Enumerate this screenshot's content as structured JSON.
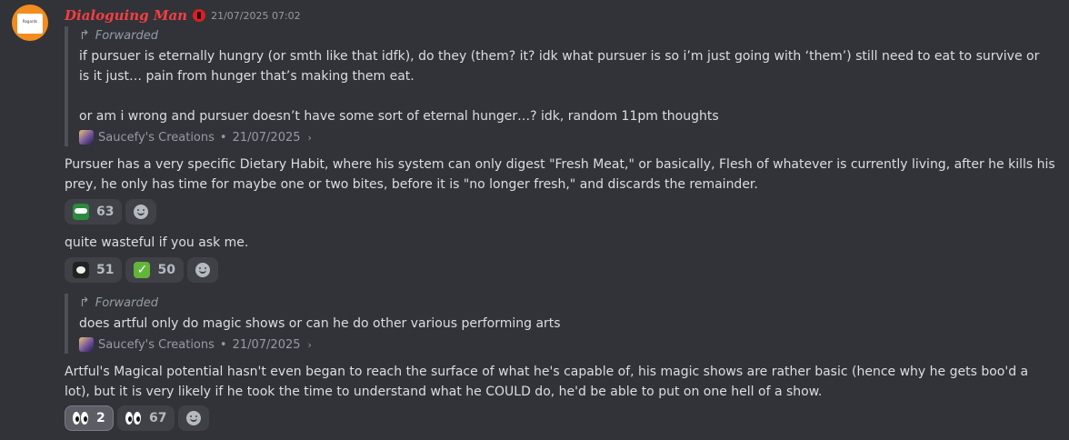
{
  "author": {
    "name": "Dialoguing Man",
    "timestamp": "21/07/2025 07:02",
    "avatar_text": "Regards"
  },
  "forward1": {
    "label": "Forwarded",
    "line1": "if pursuer is eternally hungry (or smth like that idfk), do they (them? it? idk what pursuer is so i’m just going with ‘them’) still need to eat to survive or is it just… pain from hunger that’s making them eat.",
    "line2": "or am i wrong and pursuer doesn’t have some sort of eternal hunger…? idk, random 11pm thoughts",
    "source": "Saucefy's Creations",
    "date": "21/07/2025"
  },
  "msg1": "Pursuer has a very specific Dietary Habit, where his system can only digest \"Fresh Meat,\" or basically, Flesh of whatever is currently living, after he kills his prey, he only has time for maybe one or two bites, before it is \"no longer fresh,\" and discards the remainder.",
  "reactions1": [
    {
      "icon": "green-face-emoji",
      "count": "63"
    }
  ],
  "msg2": "quite wasteful if you ask me.",
  "reactions2": [
    {
      "icon": "panda-emoji",
      "count": "51"
    },
    {
      "icon": "check-mark-emoji",
      "count": "50"
    }
  ],
  "forward2": {
    "label": "Forwarded",
    "text": "does artful only do magic shows or can he do other various performing arts",
    "source": "Saucefy's Creations",
    "date": "21/07/2025"
  },
  "msg3": "Artful's Magical potential hasn't even began to reach the surface of what he's capable of, his magic shows are rather basic (hence why he gets boo'd a lot), but it is very likely if he took the time to understand what he COULD do, he'd be able to put on one hell of a show.",
  "reactions3": [
    {
      "icon": "eyes-emoji",
      "count": "2",
      "selected": true
    },
    {
      "icon": "eyes-emoji",
      "count": "67"
    }
  ],
  "colors": {
    "background": "#323339",
    "username": "#f23f43",
    "reaction_bg": "#3f4147"
  }
}
